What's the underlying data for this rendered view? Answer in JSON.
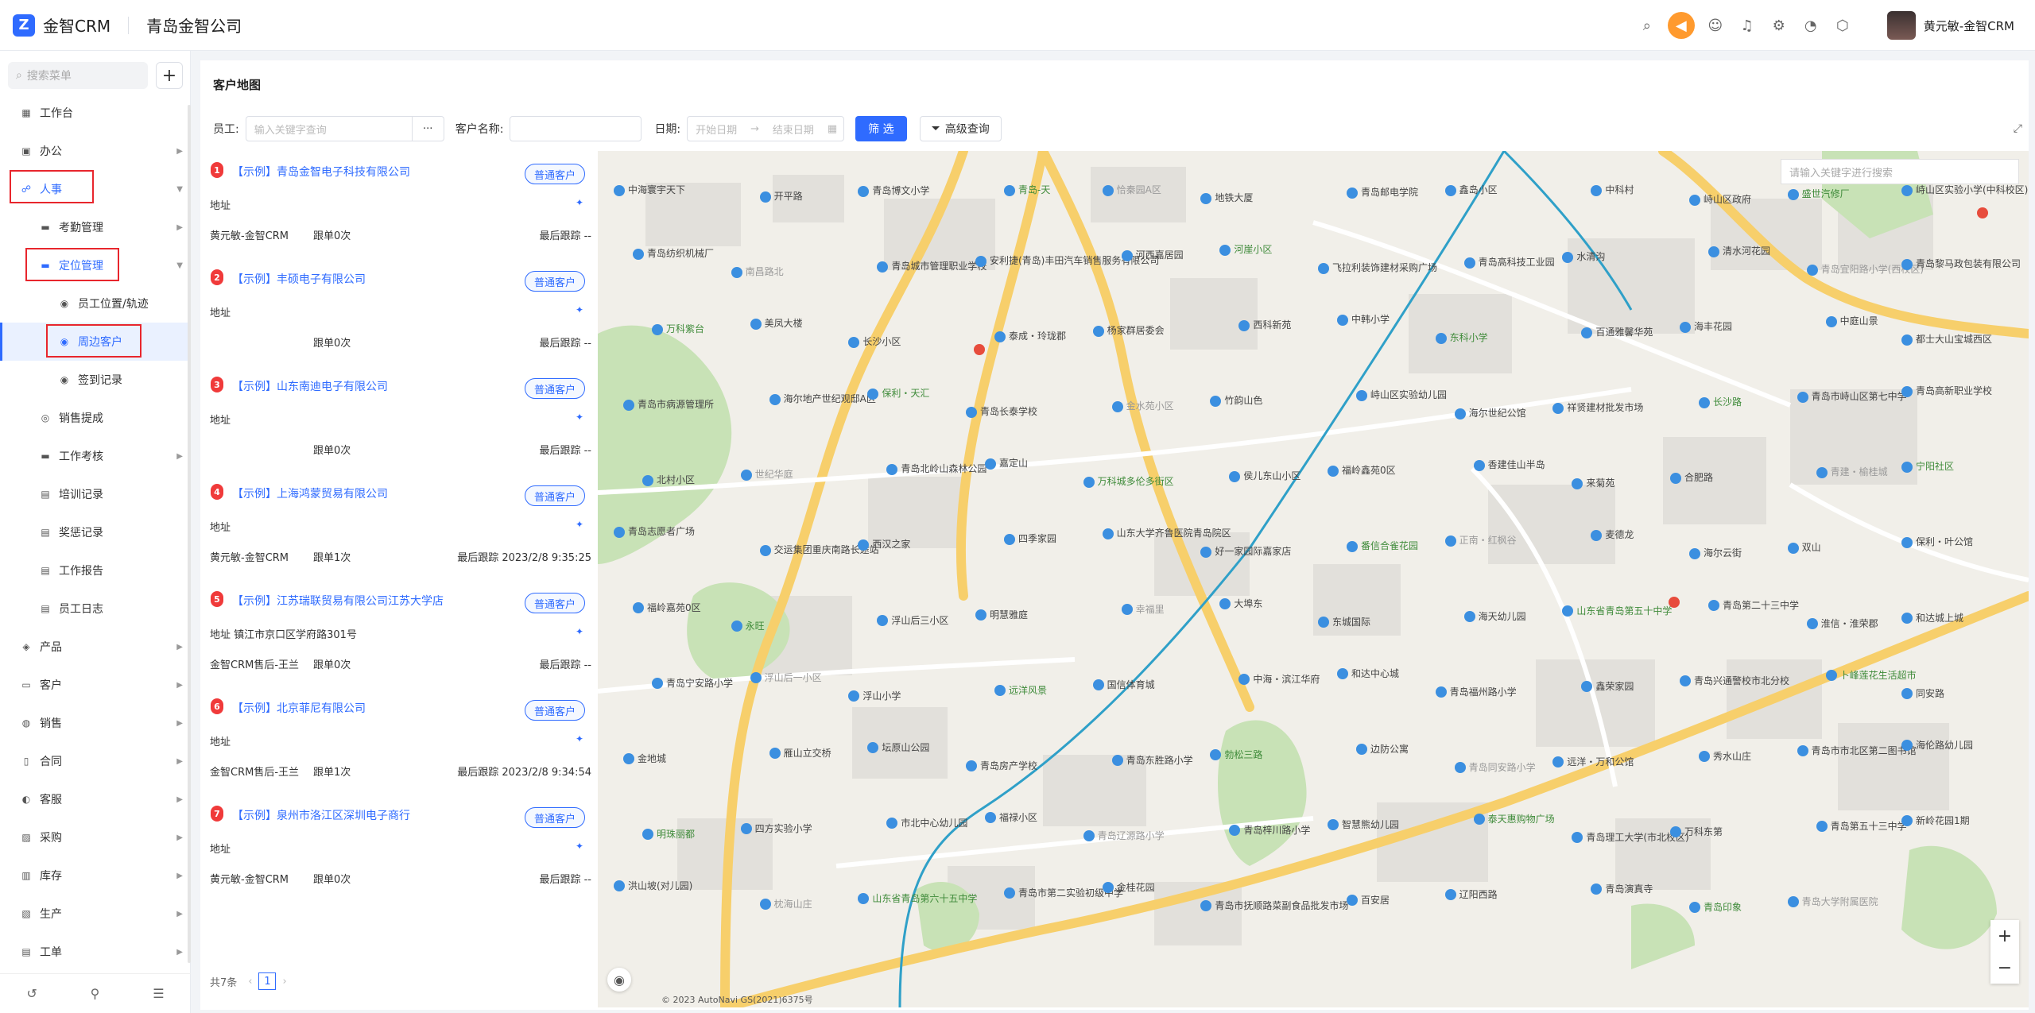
{
  "app": {
    "logo_mark": "Z",
    "name": "金智CRM",
    "company": "青岛金智公司"
  },
  "topbar": {
    "icons": [
      "search-icon",
      "speaker-icon",
      "contact-icon",
      "bell-icon",
      "gear-icon",
      "pie-chart-icon",
      "cube-icon"
    ],
    "user_name": "黄元敏-金智CRM"
  },
  "sidebar": {
    "search_placeholder": "搜索菜单",
    "add_label": "+",
    "items": [
      {
        "label": "工作台",
        "level": 1,
        "icon": "dashboard-icon",
        "arrow": false
      },
      {
        "label": "办公",
        "level": 1,
        "icon": "office-icon",
        "arrow": true
      },
      {
        "label": "人事",
        "level": 1,
        "icon": "people-icon",
        "arrow": true,
        "highlight": true
      },
      {
        "label": "考勤管理",
        "level": 2,
        "icon": "folder-icon",
        "arrow": true
      },
      {
        "label": "定位管理",
        "level": 2,
        "icon": "folder-icon",
        "arrow": true,
        "highlight": true
      },
      {
        "label": "员工位置/轨迹",
        "level": 3,
        "icon": "location-icon",
        "arrow": false
      },
      {
        "label": "周边客户",
        "level": 3,
        "icon": "location-icon",
        "arrow": false,
        "active": true
      },
      {
        "label": "签到记录",
        "level": 3,
        "icon": "location-icon",
        "arrow": false
      },
      {
        "label": "销售提成",
        "level": 2,
        "icon": "coin-icon",
        "arrow": false
      },
      {
        "label": "工作考核",
        "level": 2,
        "icon": "folder-icon",
        "arrow": true
      },
      {
        "label": "培训记录",
        "level": 2,
        "icon": "doc-icon",
        "arrow": false
      },
      {
        "label": "奖惩记录",
        "level": 2,
        "icon": "doc-icon",
        "arrow": false
      },
      {
        "label": "工作报告",
        "level": 2,
        "icon": "doc-icon",
        "arrow": false
      },
      {
        "label": "员工日志",
        "level": 2,
        "icon": "doc-icon",
        "arrow": false
      },
      {
        "label": "产品",
        "level": 1,
        "icon": "product-icon",
        "arrow": true
      },
      {
        "label": "客户",
        "level": 1,
        "icon": "customer-icon",
        "arrow": true
      },
      {
        "label": "销售",
        "level": 1,
        "icon": "sales-icon",
        "arrow": true
      },
      {
        "label": "合同",
        "level": 1,
        "icon": "contract-icon",
        "arrow": true
      },
      {
        "label": "客服",
        "level": 1,
        "icon": "service-icon",
        "arrow": true
      },
      {
        "label": "采购",
        "level": 1,
        "icon": "purchase-icon",
        "arrow": true
      },
      {
        "label": "库存",
        "level": 1,
        "icon": "stock-icon",
        "arrow": true
      },
      {
        "label": "生产",
        "level": 1,
        "icon": "production-icon",
        "arrow": true
      },
      {
        "label": "工单",
        "level": 1,
        "icon": "ticket-icon",
        "arrow": true
      }
    ],
    "bottom_icons": [
      "history-icon",
      "filter-settings-icon",
      "collapse-icon"
    ]
  },
  "page": {
    "title": "客户地图",
    "filters": {
      "employee_label": "员工:",
      "employee_placeholder": "输入关键字查询",
      "more": "···",
      "customer_label": "客户名称:",
      "customer_value": "",
      "date_label": "日期:",
      "start_placeholder": "开始日期",
      "arrow": "→",
      "end_placeholder": "结束日期",
      "filter_button": "筛 选",
      "advanced_button": "高级查询"
    }
  },
  "customers": [
    {
      "no": "1",
      "name": "【示例】青岛金智电子科技有限公司",
      "tag": "普通客户",
      "addr": "地址",
      "owner": "黄元敏-金智CRM",
      "follow": "跟单0次",
      "last": "最后跟踪  --"
    },
    {
      "no": "2",
      "name": "【示例】丰硕电子有限公司",
      "tag": "普通客户",
      "addr": "地址",
      "owner": "",
      "follow": "跟单0次",
      "last": "最后跟踪  --"
    },
    {
      "no": "3",
      "name": "【示例】山东南迪电子有限公司",
      "tag": "普通客户",
      "addr": "地址",
      "owner": "",
      "follow": "跟单0次",
      "last": "最后跟踪  --"
    },
    {
      "no": "4",
      "name": "【示例】上海鸿蒙贸易有限公司",
      "tag": "普通客户",
      "addr": "地址",
      "owner": "黄元敏-金智CRM",
      "follow": "跟单1次",
      "last": "最后跟踪  2023/2/8 9:35:25"
    },
    {
      "no": "5",
      "name": "【示例】江苏瑞联贸易有限公司江苏大学店",
      "tag": "普通客户",
      "addr": "地址  镇江市京口区学府路301号",
      "owner": "金智CRM售后-王兰",
      "follow": "跟单0次",
      "last": "最后跟踪  --"
    },
    {
      "no": "6",
      "name": "【示例】北京菲尼有限公司",
      "tag": "普通客户",
      "addr": "地址",
      "owner": "金智CRM售后-王兰",
      "follow": "跟单1次",
      "last": "最后跟踪  2023/2/8 9:34:54"
    },
    {
      "no": "7",
      "name": "【示例】泉州市洛江区深圳电子商行",
      "tag": "普通客户",
      "addr": "地址",
      "owner": "黄元敏-金智CRM",
      "follow": "跟单0次",
      "last": "最后跟踪  --"
    }
  ],
  "pagination": {
    "total": "共7条",
    "prev": "‹",
    "page": "1",
    "next": "›"
  },
  "map": {
    "search_placeholder": "请输入关键字进行搜索",
    "zoom_in": "+",
    "zoom_out": "−",
    "copyright": "© 2023 AutoNavi GS(2021)6375号",
    "labels": [
      "中海寰宇天下",
      "开平路",
      "青岛博文小学",
      "青岛-天",
      "恰秦园A区",
      "地铁大厦",
      "青岛邮电学院",
      "鑫岛小区",
      "中科村",
      "峙山区政府",
      "盛世汽修厂",
      "峙山区实验小学(中科校区)",
      "青岛纺织机械厂",
      "南昌路北",
      "青岛城市管理职业学校",
      "安利捷(青岛)丰田汽车销售服务有限公司",
      "河西嘉居园",
      "河崖小区",
      "飞拉利装饰建材采购广场",
      "青岛高科技工业园",
      "水清沟",
      "清水河花园",
      "青岛宜阳路小学(西校区)",
      "青岛黎马政包装有限公司",
      "万科紫台",
      "美凤大楼",
      "长沙小区",
      "泰成・玲珑郡",
      "杨家群居委会",
      "西科新苑",
      "中韩小学",
      "东科小学",
      "百通雅馨华苑",
      "海丰花园",
      "中庭山景",
      "都士大山宝城西区",
      "青岛市病源管理所",
      "海尔地产世纪观邸A区",
      "保利・天汇",
      "青岛长泰学校",
      "金水苑小区",
      "竹韵山色",
      "峙山区实验幼儿园",
      "海尔世纪公馆",
      "祥贤建材批发市场",
      "长沙路",
      "青岛市峙山区第七中学",
      "青岛高新职业学校",
      "北村小区",
      "世纪华庭",
      "青岛北岭山森林公园",
      "嘉定山",
      "万科城多伦多街区",
      "侯儿东山小区",
      "福岭鑫苑0区",
      "香建佳山半岛",
      "来菊苑",
      "合肥路",
      "青建・榆桂城",
      "宁阳社区",
      "青岛志愿者广场",
      "交运集团重庆南路长途站",
      "西汉之家",
      "四季家园",
      "山东大学齐鲁医院青岛院区",
      "好一家园际嘉家店",
      "番信合雀花园",
      "正南・红枫谷",
      "麦德龙",
      "海尔云街",
      "双山",
      "保利・叶公馆",
      "福岭嘉苑0区",
      "永旺",
      "浮山后三小区",
      "明慧雅庭",
      "幸福里",
      "大埠东",
      "东城国际",
      "海天幼儿园",
      "山东省青岛第五十中学",
      "青岛第二十三中学",
      "淮信・淮荣郡",
      "和达城上城",
      "青岛宁安路小学",
      "浮山后一小区",
      "浮山小学",
      "远洋风景",
      "国信体育城",
      "中海・滨江华府",
      "和达中心城",
      "青岛福州路小学",
      "鑫荣家园",
      "青岛兴通警校市北分校",
      "卜峰莲花生活超市",
      "同安路",
      "金地城",
      "雁山立交桥",
      "坛原山公园",
      "青岛房产学校",
      "青岛东胜路小学",
      "勃松三路",
      "边防公寓",
      "青岛同安路小学",
      "远洋・万和公馆",
      "秀水山庄",
      "青岛市市北区第二图书馆",
      "海伦路幼儿园",
      "明珠丽都",
      "四方实验小学",
      "市北中心幼儿园",
      "福禄小区",
      "青岛辽源路小学",
      "青岛梓川路小学",
      "智慧熊幼儿园",
      "泰天惠购物广场",
      "青岛理工大学(市北校区)",
      "万科东第",
      "青岛第五十三中学",
      "新岭花园1期",
      "洪山坡(对儿园)",
      "枕海山庄",
      "山东省青岛第六十五中学",
      "青岛市第二实验初级中学",
      "金桂花园",
      "青岛市抚顺路菜副食品批发市场",
      "百安居",
      "辽阳西路",
      "青岛演真寺",
      "青岛印象",
      "青岛大学附属医院"
    ]
  }
}
